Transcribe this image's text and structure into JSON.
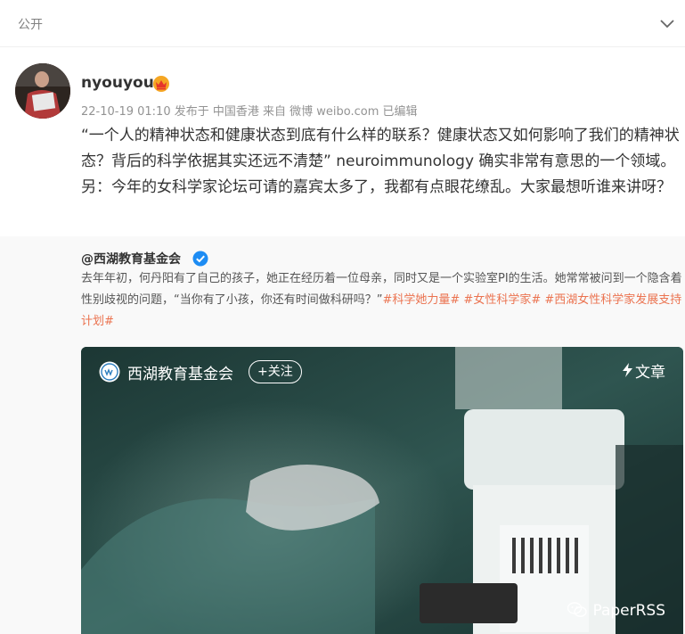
{
  "header": {
    "visibility": "公开"
  },
  "post": {
    "username": "nyouyou",
    "meta": "22-10-19 01:10  发布于 中国香港  来自 微博 weibo.com  已编辑",
    "text": "“一个人的精神状态和健康状态到底有什么样的联系？健康状态又如何影响了我们的精神状态？背后的科学依据其实还远不清楚” neuroimmunology 确实非常有意思的一个领域。另：今年的女科学家论坛可请的嘉宾太多了，我都有点眼花缭乱。大家最想听谁来讲呀？"
  },
  "repost": {
    "author": "@西湖教育基金会",
    "text": "去年年初，何丹阳有了自己的孩子，她正在经历着一位母亲，同时又是一个实验室PI的生活。她常常被问到一个隐含着性别歧视的问题，“当你有了小孩，你还有时间做科研吗？”",
    "tags": [
      "#科学她力量#",
      "#女性科学家#",
      "#西湖女性科学家发展支持计划#"
    ],
    "card": {
      "name": "西湖教育基金会",
      "follow_label": "+关注",
      "article_label": "文章",
      "watermark": "PaperRSS"
    }
  },
  "colors": {
    "accent": "#eb7350",
    "verify": "#1d8cf3",
    "vip": "#f5a623"
  },
  "icons": [
    "chevron-down-icon",
    "vip-crown-icon",
    "verified-icon",
    "lightning-icon",
    "wechat-icon"
  ]
}
